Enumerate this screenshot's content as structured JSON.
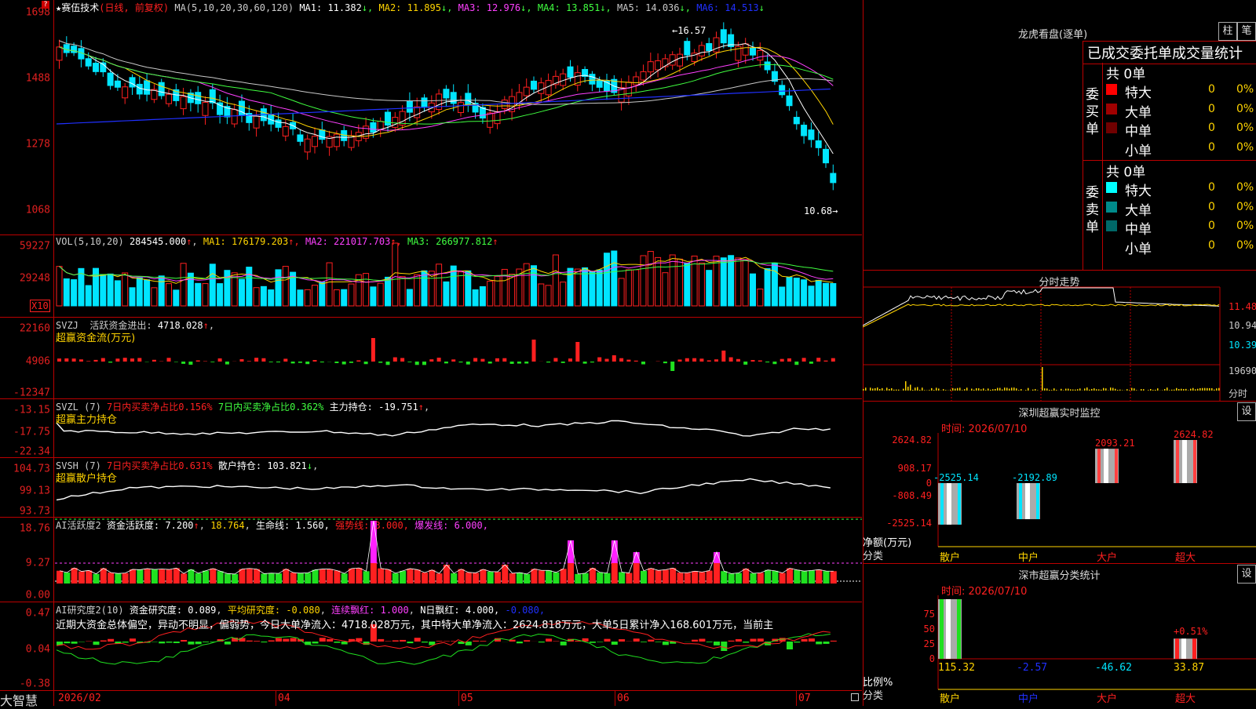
{
  "app": {
    "name": "大智慧"
  },
  "stock": {
    "name": "★赛伍技术",
    "mode": "(日线, 前复权)"
  },
  "main": {
    "ma_params": "MA(5,10,20,30,60,120)",
    "ma": [
      {
        "label": "MA1:",
        "value": "11.382",
        "arrow": "↓",
        "color": "#ffffff"
      },
      {
        "label": "MA2:",
        "value": "11.895",
        "arrow": "↓",
        "color": "#ffd400"
      },
      {
        "label": "MA3:",
        "value": "12.976",
        "arrow": "↓",
        "color": "#ff40ff"
      },
      {
        "label": "MA4:",
        "value": "13.851",
        "arrow": "↓",
        "color": "#40ff40"
      },
      {
        "label": "MA5:",
        "value": "14.036",
        "arrow": "↓",
        "color": "#c8c8c8"
      },
      {
        "label": "MA6:",
        "value": "14.513",
        "arrow": "↓",
        "color": "#2030ff"
      }
    ],
    "y_ticks": [
      "1698",
      "1488",
      "1278",
      "1068"
    ],
    "high_label": "16.57",
    "low_label": "10.68"
  },
  "vol": {
    "name": "VOL(5,10,20)",
    "value": "284545.000",
    "arrow": "↑",
    "ma": [
      {
        "label": "MA1:",
        "value": "176179.203",
        "arrow": "↑",
        "color": "#ffd400"
      },
      {
        "label": "MA2:",
        "value": "221017.703",
        "arrow": "↑",
        "color": "#ff40ff"
      },
      {
        "label": "MA3:",
        "value": "266977.812",
        "arrow": "↑",
        "color": "#40ff40"
      }
    ],
    "y_ticks": [
      "59227",
      "29248"
    ],
    "unit": "X10"
  },
  "svzj": {
    "name": "SVZJ",
    "desc": "活跃资金进出:",
    "value": "4718.028",
    "arrow": "↑",
    "sub": "超赢资金流(万元)",
    "y_ticks": [
      "22160",
      "4906",
      "-12347"
    ]
  },
  "svzl": {
    "name": "SVZL (7)",
    "t1": "7日内买卖净占比0.156%",
    "t2": "7日内买卖净占比0.362%",
    "t3": "主力持仓:",
    "value": "-19.751",
    "arrow": "↑",
    "sub": "超赢主力持仓",
    "y_ticks": [
      "-13.15",
      "-17.75",
      "-22.34"
    ]
  },
  "svsh": {
    "name": "SVSH (7)",
    "t1": "7日内买卖净占比0.631%",
    "t2": "散户持仓:",
    "value": "103.821",
    "arrow": "↓",
    "sub": "超赢散户持仓",
    "y_ticks": [
      "104.73",
      "99.13",
      "93.73"
    ]
  },
  "ai1": {
    "name": "AI活跃度2",
    "t1": "资金活跃度:",
    "v1": "7.200",
    "v2": "18.764",
    "t3": "生命线:",
    "v3": "1.560,",
    "t4": "强势线:",
    "v4": "3.000,",
    "t5": "爆发线:",
    "v5": "6.000,",
    "y_ticks": [
      "18.76",
      "9.27",
      "0.00"
    ]
  },
  "ai2": {
    "name": "AI研究度2(10)",
    "t1": "资金研究度:",
    "v1": "0.089",
    "t2": "平均研究度:",
    "v2": "-0.080",
    "t3": "连续飘红:",
    "v3": "1.000",
    "t4": "N日飘红:",
    "v4": "4.000,",
    "v5": "-0.080",
    "text": "近期大资金总体偏空，异动不明显，偏弱势，今日大单净流入：4718.028万元，其中特大单净流入：2624.818万元，大单5日累计净入168.601万元，当前主",
    "y_ticks": [
      "0.47",
      "0.04",
      "-0.38"
    ]
  },
  "xaxis": [
    "2026/02",
    "04",
    "05",
    "06",
    "07"
  ],
  "lhb": {
    "title": "龙虎看盘(逐单)",
    "btn1": "柱",
    "btn2": "笔",
    "header": "已成交委托单成交量统计",
    "buy_label": "委买单",
    "sell_label": "委卖单",
    "buy_total": "共 0单",
    "sell_total": "共 0单",
    "buy_rows": [
      {
        "label": "特大",
        "count": "0",
        "pct": "0%",
        "color": "#ff0000"
      },
      {
        "label": "大单",
        "count": "0",
        "pct": "0%",
        "color": "#a00000"
      },
      {
        "label": "中单",
        "count": "0",
        "pct": "0%",
        "color": "#700000"
      },
      {
        "label": "小单",
        "count": "0",
        "pct": "0%",
        "color": ""
      }
    ],
    "sell_rows": [
      {
        "label": "特大",
        "count": "0",
        "pct": "0%",
        "color": "#00ffff"
      },
      {
        "label": "大单",
        "count": "0",
        "pct": "0%",
        "color": "#008b8b"
      },
      {
        "label": "中单",
        "count": "0",
        "pct": "0%",
        "color": "#006868"
      },
      {
        "label": "小单",
        "count": "0",
        "pct": "0%",
        "color": ""
      }
    ]
  },
  "intraday": {
    "title": "分时走势",
    "y_ticks": [
      "11.48",
      "10.94",
      "10.39"
    ],
    "vol_tick": "19690",
    "unit": "分时"
  },
  "monitor": {
    "title": "深圳超赢实时监控",
    "btn": "设",
    "time": "时间: 2026/07/10",
    "y_ticks": [
      "2624.82",
      "908.17",
      "0",
      "-808.49",
      "-2525.14"
    ],
    "ylabel": "净额(万元)",
    "xlabel": "分类",
    "bars": [
      {
        "cat": "散户",
        "value": -2525.14,
        "label": "-2525.14"
      },
      {
        "cat": "中户",
        "value": -2192.89,
        "label": "-2192.89"
      },
      {
        "cat": "大户",
        "value": 2093.21,
        "label": "2093.21"
      },
      {
        "cat": "超大",
        "value": 2624.82,
        "label": "2624.82"
      }
    ]
  },
  "classify": {
    "title": "深市超赢分类统计",
    "btn": "设",
    "time": "时间: 2026/07/10",
    "y_ticks": [
      "75",
      "50",
      "25",
      "0"
    ],
    "ylabel": "比例%",
    "xlabel": "分类",
    "bars": [
      {
        "cat": "散户",
        "value": 115.32,
        "label": "115.32"
      },
      {
        "cat": "中户",
        "value": -2.57,
        "label": "-2.57"
      },
      {
        "cat": "大户",
        "value": -46.62,
        "label": "-46.62"
      },
      {
        "cat": "超大",
        "value": 33.87,
        "label": "33.87"
      }
    ],
    "annot": "+0.51%"
  },
  "colors": {
    "up": "#ff2020",
    "down": "#00e5ff",
    "grid": "#b00000"
  }
}
